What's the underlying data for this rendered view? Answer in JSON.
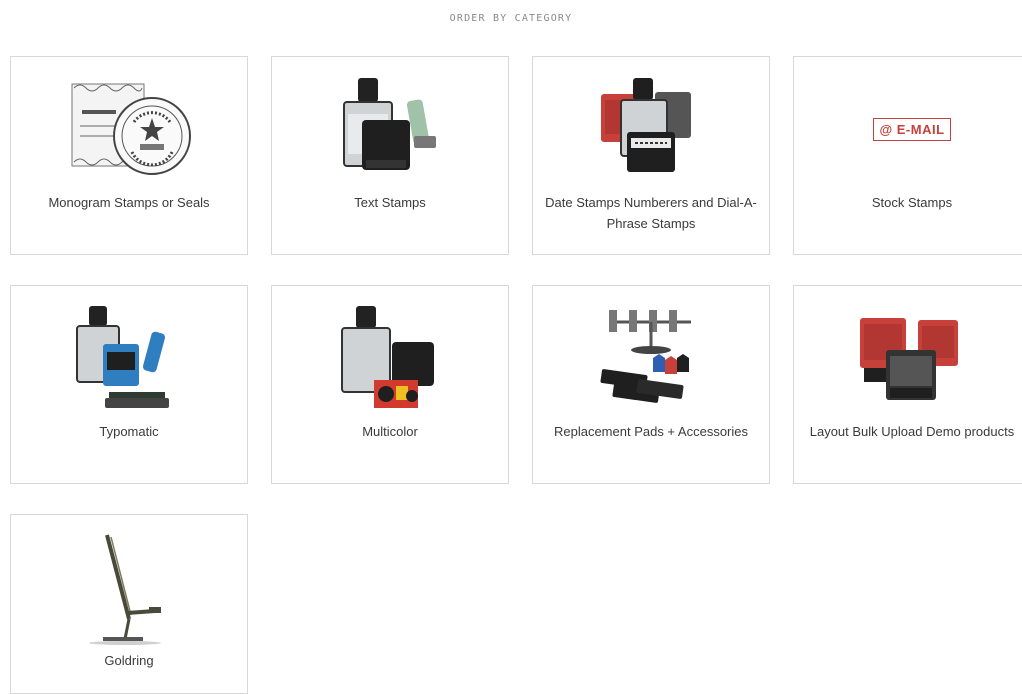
{
  "heading": "ORDER BY CATEGORY",
  "categories": [
    {
      "label": "Monogram Stamps or Seals",
      "icon": "seal-stamp-image"
    },
    {
      "label": "Text Stamps",
      "icon": "text-stamp-image"
    },
    {
      "label": "Date Stamps Numberers and Dial-A-Phrase Stamps",
      "icon": "date-stamp-image"
    },
    {
      "label": "Stock Stamps",
      "icon": "email-stock-stamp-image",
      "image_text": "@ E-MAIL"
    },
    {
      "label": "Typomatic",
      "icon": "typomatic-stamp-image"
    },
    {
      "label": "Multicolor",
      "icon": "multicolor-stamp-image"
    },
    {
      "label": "Replacement Pads + Accessories",
      "icon": "ink-pads-image"
    },
    {
      "label": "Layout Bulk Upload Demo products",
      "icon": "red-stamps-image"
    },
    {
      "label": "Goldring",
      "icon": "goldring-stamp-image"
    }
  ],
  "colors": {
    "border": "#d8d8d8",
    "heading": "#8a8a8a",
    "text": "#3a3a3a",
    "stamp_red": "#c8403a",
    "stamp_black": "#1f1f1f",
    "stamp_blue": "#2f7fc0"
  }
}
